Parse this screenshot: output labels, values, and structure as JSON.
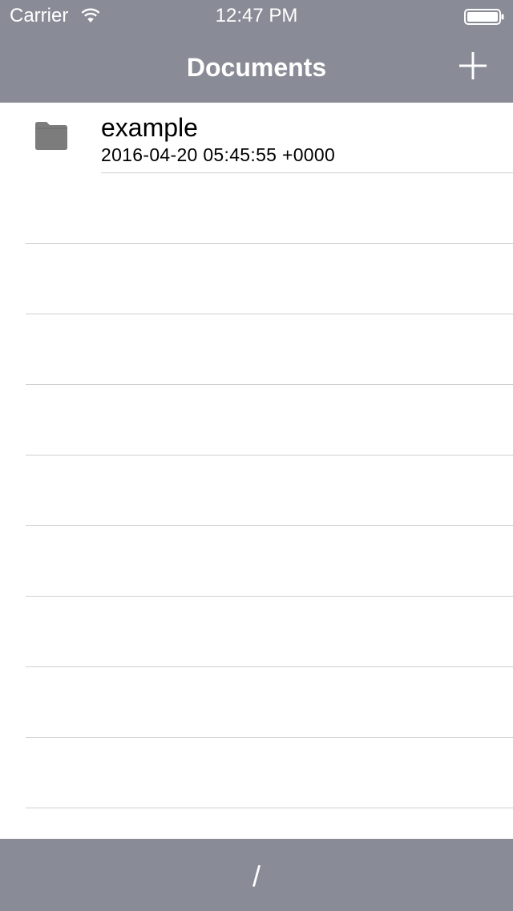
{
  "status_bar": {
    "carrier": "Carrier",
    "time": "12:47 PM",
    "wifi_icon": "wifi-icon",
    "battery_icon": "battery-icon"
  },
  "nav_bar": {
    "title": "Documents",
    "add_icon": "plus-icon"
  },
  "files": [
    {
      "name": "example",
      "date": "2016-04-20 05:45:55 +0000",
      "icon": "folder-icon"
    }
  ],
  "bottom_bar": {
    "path": "/"
  },
  "colors": {
    "bar_background": "#898b96",
    "bar_foreground": "#ffffff",
    "separator": "#cfcfd3",
    "folder_icon": "#7c7c7c"
  }
}
